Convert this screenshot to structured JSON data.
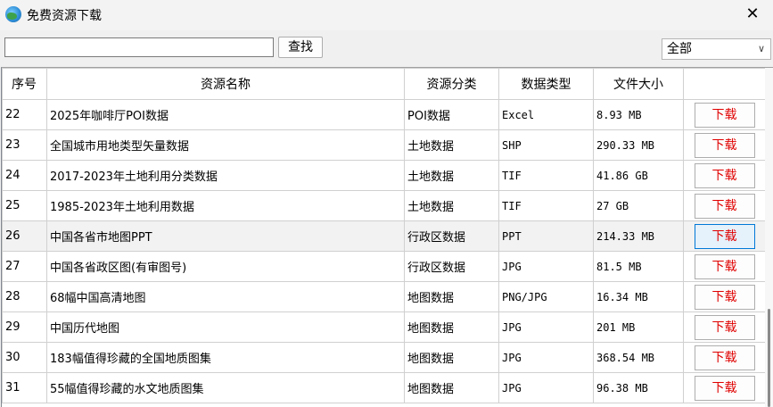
{
  "window": {
    "title": "免费资源下载",
    "close_glyph": "✕"
  },
  "search": {
    "value": "",
    "button_label": "查找"
  },
  "filter": {
    "selected": "全部"
  },
  "table": {
    "headers": [
      "序号",
      "资源名称",
      "资源分类",
      "数据类型",
      "文件大小",
      ""
    ],
    "download_label": "下载",
    "rows": [
      {
        "no": "22",
        "name": "2025年咖啡厅POI数据",
        "category": "POI数据",
        "type": "Excel",
        "size": "8.93 MB"
      },
      {
        "no": "23",
        "name": "全国城市用地类型矢量数据",
        "category": "土地数据",
        "type": "SHP",
        "size": "290.33 MB"
      },
      {
        "no": "24",
        "name": "2017-2023年土地利用分类数据",
        "category": "土地数据",
        "type": "TIF",
        "size": "41.86 GB"
      },
      {
        "no": "25",
        "name": "1985-2023年土地利用数据",
        "category": "土地数据",
        "type": "TIF",
        "size": "27 GB"
      },
      {
        "no": "26",
        "name": "中国各省市地图PPT",
        "category": "行政区数据",
        "type": "PPT",
        "size": "214.33 MB"
      },
      {
        "no": "27",
        "name": "中国各省政区图(有审图号)",
        "category": "行政区数据",
        "type": "JPG",
        "size": "81.5 MB"
      },
      {
        "no": "28",
        "name": "68幅中国高清地图",
        "category": "地图数据",
        "type": "PNG/JPG",
        "size": "16.34 MB"
      },
      {
        "no": "29",
        "name": "中国历代地图",
        "category": "地图数据",
        "type": "JPG",
        "size": "201 MB"
      },
      {
        "no": "30",
        "name": "183幅值得珍藏的全国地质图集",
        "category": "地图数据",
        "type": "JPG",
        "size": "368.54 MB"
      },
      {
        "no": "31",
        "name": "55幅值得珍藏的水文地质图集",
        "category": "地图数据",
        "type": "JPG",
        "size": "96.38 MB"
      }
    ]
  }
}
